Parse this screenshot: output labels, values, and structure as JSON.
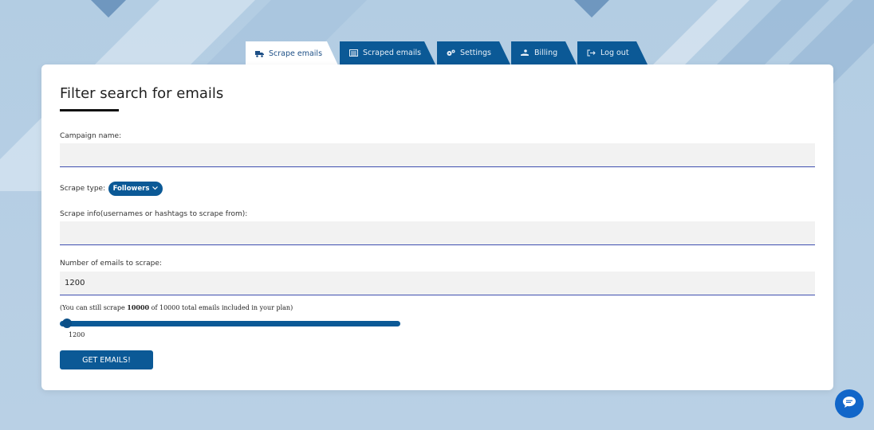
{
  "tabs": [
    {
      "label": "Scrape emails",
      "icon": "truck-icon",
      "active": true
    },
    {
      "label": "Scraped emails",
      "icon": "list-icon",
      "active": false
    },
    {
      "label": "Settings",
      "icon": "gears-icon",
      "active": false
    },
    {
      "label": "Billing",
      "icon": "hand-coin-icon",
      "active": false
    },
    {
      "label": "Log out",
      "icon": "sign-out-icon",
      "active": false
    }
  ],
  "form": {
    "title": "Filter search for emails",
    "campaign_label": "Campaign name:",
    "campaign_value": "",
    "scrape_type_label": "Scrape type:",
    "scrape_type_selected": "Followers",
    "scrape_info_label": "Scrape info(usernames or hashtags to scrape from):",
    "scrape_info_value": "",
    "count_label": "Number of emails to scrape:",
    "count_value": "1200",
    "note_prefix": "(You can still scrape ",
    "note_remaining": "10000",
    "note_suffix": " of 10000 total emails included in your plan)",
    "slider_value": "1200",
    "slider_fraction": 0.12,
    "submit_label": "GET EMAILS!"
  },
  "colors": {
    "accent": "#0b5996",
    "chat_button": "#1166c9",
    "field_underline": "#3f4fb0"
  }
}
